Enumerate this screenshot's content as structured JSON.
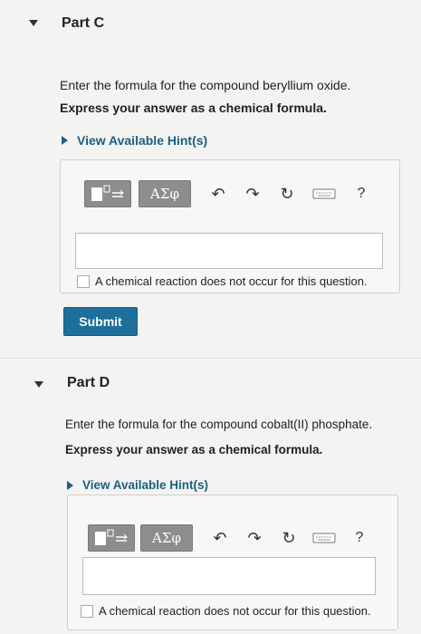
{
  "part_c": {
    "title": "Part C",
    "prompt": "Enter the formula for the compound beryllium oxide.",
    "instruction": "Express your answer as a chemical formula.",
    "hint_label": "View Available Hint(s)",
    "toolbar": {
      "template_label": "",
      "symbols_label": "ΑΣφ",
      "help_label": "?"
    },
    "answer_value": "",
    "no_reaction_label": "A chemical reaction does not occur for this question.",
    "submit_label": "Submit"
  },
  "part_d": {
    "title": "Part D",
    "prompt": "Enter the formula for the compound cobalt(II) phosphate.",
    "instruction": "Express your answer as a chemical formula.",
    "hint_label": "View Available Hint(s)",
    "toolbar": {
      "symbols_label": "ΑΣφ",
      "help_label": "?"
    },
    "answer_value": "",
    "no_reaction_label": "A chemical reaction does not occur for this question."
  },
  "colors": {
    "accent": "#1f6f9c",
    "hint_text": "#1b5e86",
    "toolbar_button": "#8d8d8d",
    "background": "#f3f3f1"
  }
}
